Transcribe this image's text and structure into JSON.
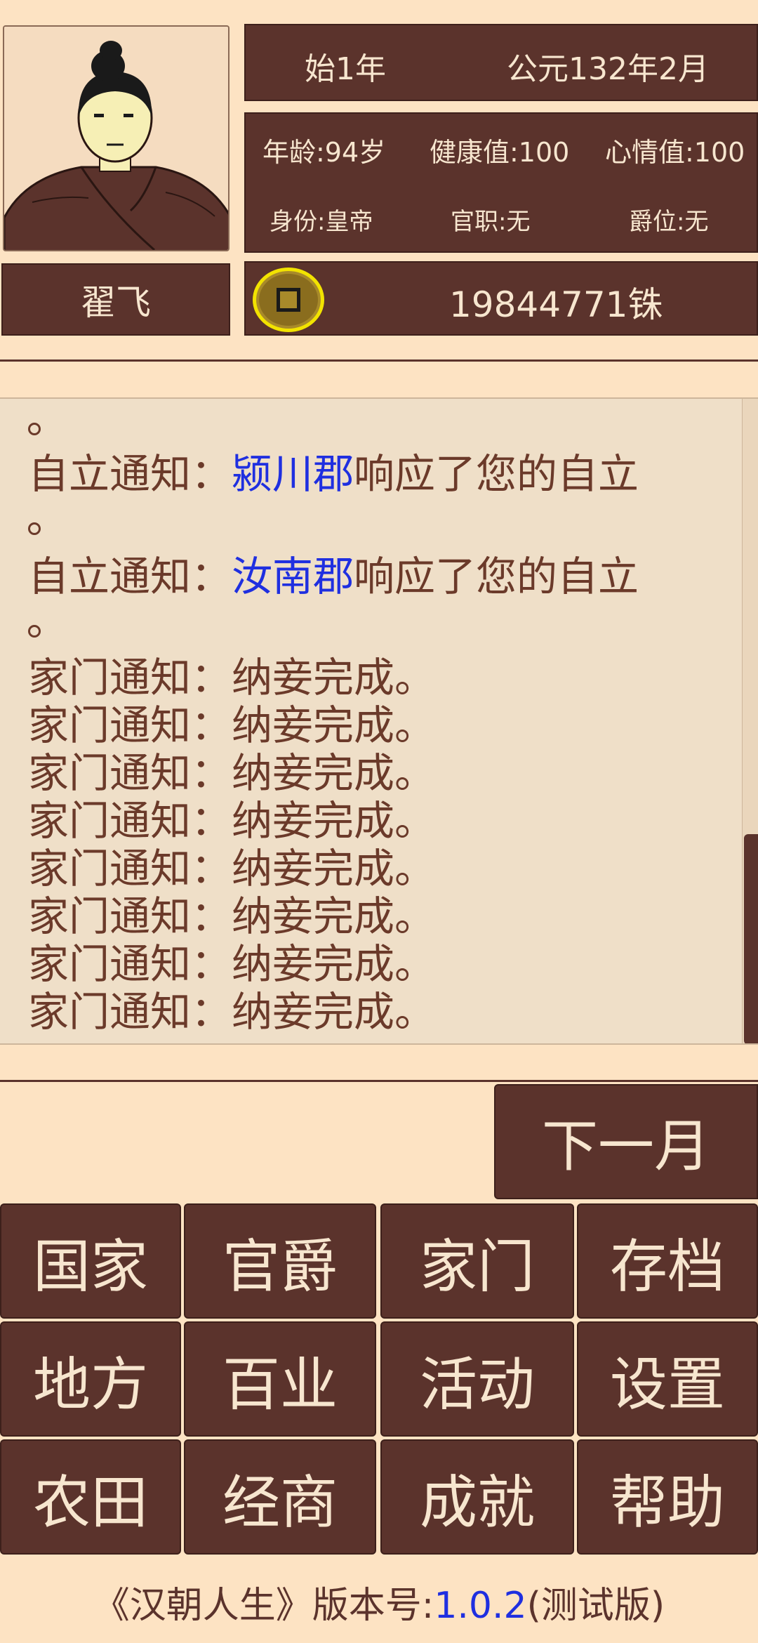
{
  "player": {
    "name": "翟飞",
    "era": "始1年",
    "calendar": "公元132年2月",
    "age": "年龄:94岁",
    "health": "健康值:100",
    "mood": "心情值:100",
    "identity": "身份:皇帝",
    "office": "官职:无",
    "title": "爵位:无",
    "money": "19844771铢"
  },
  "log": {
    "dot": "。",
    "lines": [
      {
        "prefix": "自立通知：",
        "place": "颍川郡",
        "suffix": "响应了您的自立"
      },
      {
        "prefix": "自立通知：",
        "place": "汝南郡",
        "suffix": "响应了您的自立"
      },
      {
        "text": "家门通知：纳妾完成。"
      },
      {
        "text": "家门通知：纳妾完成。"
      },
      {
        "text": "家门通知：纳妾完成。"
      },
      {
        "text": "家门通知：纳妾完成。"
      },
      {
        "text": "家门通知：纳妾完成。"
      },
      {
        "text": "家门通知：纳妾完成。"
      },
      {
        "text": "家门通知：纳妾完成。"
      },
      {
        "text": "家门通知：纳妾完成。"
      }
    ]
  },
  "actions": {
    "next_month": "下一月",
    "menu": [
      "国家",
      "官爵",
      "家门",
      "存档",
      "地方",
      "百业",
      "活动",
      "设置",
      "农田",
      "经商",
      "成就",
      "帮助"
    ]
  },
  "footer": {
    "prefix": "《汉朝人生》版本号:",
    "version": "1.0.2",
    "suffix": "(测试版)"
  },
  "colors": {
    "background": "#fde3c3",
    "panel": "#5b332c",
    "panel_text": "#f7e6cf",
    "log_text": "#6b3a2a",
    "link_blue": "#1f2fe0"
  }
}
